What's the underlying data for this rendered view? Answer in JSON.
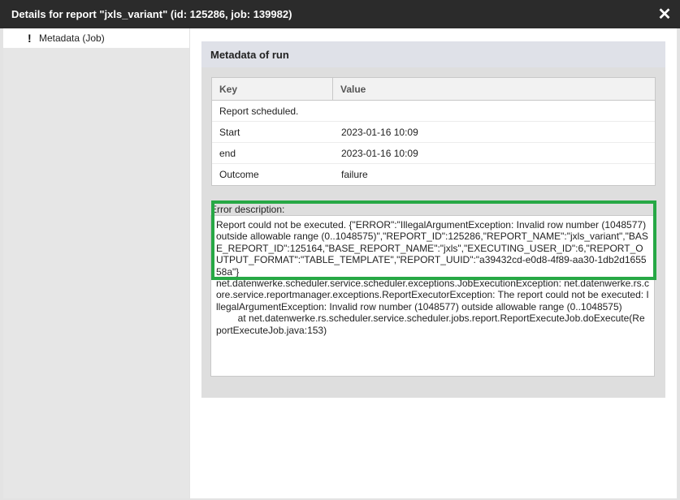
{
  "window": {
    "title": "Details for report \"jxls_variant\" (id: 125286, job: 139982)",
    "close_symbol": "✕"
  },
  "sidebar": {
    "items": [
      {
        "icon": "!",
        "label": "Metadata (Job)"
      }
    ]
  },
  "panel": {
    "title": "Metadata of run",
    "columns": {
      "key": "Key",
      "value": "Value"
    },
    "rows": [
      {
        "key": "Report scheduled.",
        "value": ""
      },
      {
        "key": "Start",
        "value": "2023-01-16 10:09"
      },
      {
        "key": "end",
        "value": "2023-01-16 10:09"
      },
      {
        "key": "Outcome",
        "value": "failure"
      }
    ],
    "error_label": "Error description:",
    "error_text": "Report could not be executed. {\"ERROR\":\"IllegalArgumentException: Invalid row number (1048577) outside allowable range (0..1048575)\",\"REPORT_ID\":125286,\"REPORT_NAME\":\"jxls_variant\",\"BASE_REPORT_ID\":125164,\"BASE_REPORT_NAME\":\"jxls\",\"EXECUTING_USER_ID\":6,\"REPORT_OUTPUT_FORMAT\":\"TABLE_TEMPLATE\",\"REPORT_UUID\":\"a39432cd-e0d8-4f89-aa30-1db2d165558a\"}\nnet.datenwerke.scheduler.service.scheduler.exceptions.JobExecutionException: net.datenwerke.rs.core.service.reportmanager.exceptions.ReportExecutorException: The report could not be executed: IllegalArgumentException: Invalid row number (1048577) outside allowable range (0..1048575)\n        at net.datenwerke.rs.scheduler.service.scheduler.jobs.report.ReportExecuteJob.doExecute(ReportExecuteJob.java:153)"
  },
  "colors": {
    "titlebar": "#2b2b2b",
    "highlight": "#27a845"
  }
}
